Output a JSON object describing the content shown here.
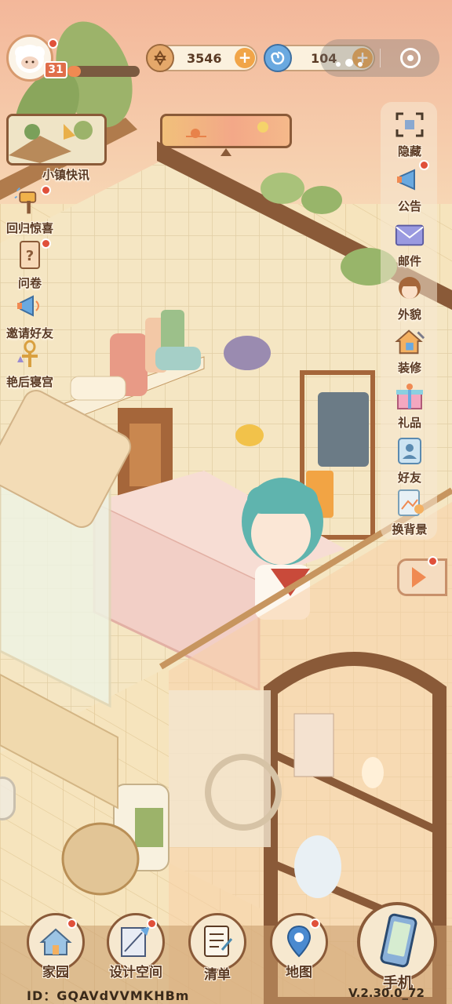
{
  "player": {
    "level": "31",
    "avatar_icon": "sheep-avatar-icon"
  },
  "currency": {
    "coins": "3546",
    "coins_icon": "coin-icon",
    "gems": "104",
    "gems_icon": "swirl-gem-icon"
  },
  "news": {
    "label": "小镇快讯"
  },
  "left_menu": [
    {
      "label": "回归惊喜",
      "icon": "hammer-gift-icon"
    },
    {
      "label": "问卷",
      "icon": "questionnaire-icon"
    },
    {
      "label": "邀请好友",
      "icon": "megaphone-icon"
    },
    {
      "label": "艳后寝宫",
      "icon": "ankh-crown-icon"
    }
  ],
  "right_menu": [
    {
      "label": "隐藏",
      "icon": "hide-frame-icon"
    },
    {
      "label": "公告",
      "icon": "announcement-icon"
    },
    {
      "label": "邮件",
      "icon": "mail-icon"
    },
    {
      "label": "外貌",
      "icon": "appearance-icon"
    },
    {
      "label": "装修",
      "icon": "renovate-icon"
    },
    {
      "label": "礼品",
      "icon": "gift-icon"
    },
    {
      "label": "好友",
      "icon": "friends-icon"
    },
    {
      "label": "换背景",
      "icon": "background-icon"
    }
  ],
  "bottom_nav": [
    {
      "label": "家园",
      "icon": "home-icon"
    },
    {
      "label": "设计空间",
      "icon": "design-space-icon"
    },
    {
      "label": "清单",
      "icon": "checklist-icon"
    },
    {
      "label": "地图",
      "icon": "map-pin-icon"
    },
    {
      "label": "手机",
      "icon": "phone-icon"
    }
  ],
  "footer": {
    "player_id": "ID：GQAVdVVMKHBm",
    "version": "V.2.30.0_72"
  },
  "colors": {
    "wall": "#f5e6c3",
    "tile_line": "#e2cfa4",
    "bath": "#f2cfc6",
    "character_hair": "#5fb4ae",
    "badge": "#e0503a",
    "label_text": "#5a3a24"
  }
}
